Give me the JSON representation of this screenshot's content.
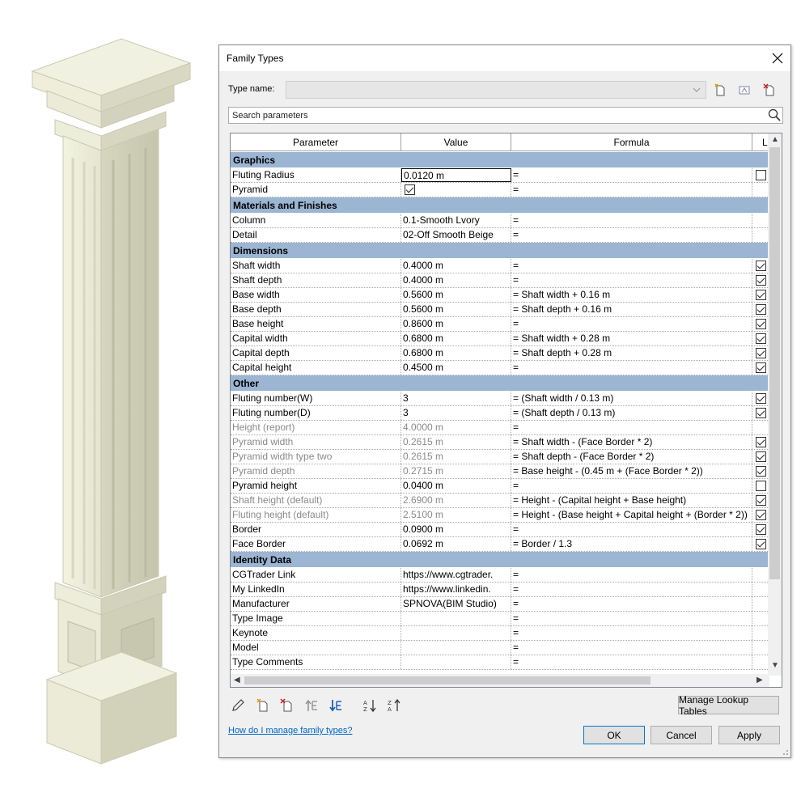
{
  "dialog": {
    "title": "Family Types",
    "type_name_label": "Type name:",
    "type_name_value": "",
    "search_placeholder": "Search parameters",
    "columns": {
      "parameter": "Parameter",
      "value": "Value",
      "formula": "Formula",
      "lock": "L"
    },
    "groups": [
      {
        "name": "Graphics",
        "rows": [
          {
            "parameter": "Fluting Radius",
            "value": "0.0120 m",
            "formula": "=",
            "lock": false,
            "disabled": false,
            "editing": true
          },
          {
            "parameter": "Pyramid",
            "value_checkbox": true,
            "value": "",
            "formula": "=",
            "lock": null,
            "disabled": false
          }
        ]
      },
      {
        "name": "Materials and Finishes",
        "rows": [
          {
            "parameter": "Column",
            "value": "0.1-Smooth Lvory",
            "formula": "=",
            "lock": null,
            "disabled": false
          },
          {
            "parameter": "Detail",
            "value": "02-Off Smooth Beige",
            "formula": "=",
            "lock": null,
            "disabled": false
          }
        ]
      },
      {
        "name": "Dimensions",
        "rows": [
          {
            "parameter": "Shaft width",
            "value": "0.4000 m",
            "formula": "=",
            "lock": true,
            "disabled": false
          },
          {
            "parameter": "Shaft depth",
            "value": "0.4000 m",
            "formula": "=",
            "lock": true,
            "disabled": false
          },
          {
            "parameter": "Base width",
            "value": "0.5600 m",
            "formula": "= Shaft width + 0.16 m",
            "lock": true,
            "disabled": false
          },
          {
            "parameter": "Base depth",
            "value": "0.5600 m",
            "formula": "= Shaft depth + 0.16 m",
            "lock": true,
            "disabled": false
          },
          {
            "parameter": "Base height",
            "value": "0.8600 m",
            "formula": "=",
            "lock": true,
            "disabled": false
          },
          {
            "parameter": "Capital width",
            "value": "0.6800 m",
            "formula": "= Shaft width + 0.28 m",
            "lock": true,
            "disabled": false
          },
          {
            "parameter": "Capital depth",
            "value": "0.6800 m",
            "formula": "= Shaft depth + 0.28 m",
            "lock": true,
            "disabled": false
          },
          {
            "parameter": "Capital height",
            "value": "0.4500 m",
            "formula": "=",
            "lock": true,
            "disabled": false
          }
        ]
      },
      {
        "name": "Other",
        "rows": [
          {
            "parameter": "Fluting number(W)",
            "value": "3",
            "formula": "= (Shaft width / 0.13 m)",
            "lock": true,
            "disabled": false
          },
          {
            "parameter": "Fluting number(D)",
            "value": "3",
            "formula": "= (Shaft depth / 0.13 m)",
            "lock": true,
            "disabled": false
          },
          {
            "parameter": "Height (report)",
            "value": "4.0000 m",
            "formula": "=",
            "lock": null,
            "disabled": true
          },
          {
            "parameter": "Pyramid width",
            "value": "0.2615 m",
            "formula": "= Shaft width - (Face Border * 2)",
            "lock": true,
            "disabled": true
          },
          {
            "parameter": "Pyramid width type two",
            "value": "0.2615 m",
            "formula": "= Shaft depth - (Face Border * 2)",
            "lock": true,
            "disabled": true
          },
          {
            "parameter": "Pyramid depth",
            "value": "0.2715 m",
            "formula": "= Base height - (0.45 m + (Face Border * 2))",
            "lock": true,
            "disabled": true
          },
          {
            "parameter": "Pyramid height",
            "value": "0.0400 m",
            "formula": "=",
            "lock": false,
            "disabled": false
          },
          {
            "parameter": "Shaft height (default)",
            "value": "2.6900 m",
            "formula": "= Height - (Capital height + Base height)",
            "lock": true,
            "disabled": true
          },
          {
            "parameter": "Fluting height (default)",
            "value": "2.5100 m",
            "formula": "= Height - (Base height + Capital height + (Border * 2))",
            "lock": true,
            "disabled": true
          },
          {
            "parameter": "Border",
            "value": "0.0900 m",
            "formula": "=",
            "lock": true,
            "disabled": false
          },
          {
            "parameter": "Face Border",
            "value": "0.0692 m",
            "formula": "= Border / 1.3",
            "lock": true,
            "disabled": false
          }
        ]
      },
      {
        "name": "Identity Data",
        "rows": [
          {
            "parameter": "CGTrader Link",
            "value": "https://www.cgtrader.",
            "formula": "=",
            "lock": null,
            "disabled": false
          },
          {
            "parameter": "My LinkedIn",
            "value": "https://www.linkedin.",
            "formula": "=",
            "lock": null,
            "disabled": false
          },
          {
            "parameter": "Manufacturer",
            "value": "SPNOVA(BIM Studio)",
            "formula": "=",
            "lock": null,
            "disabled": false
          },
          {
            "parameter": "Type Image",
            "value": "",
            "formula": "=",
            "lock": null,
            "disabled": false
          },
          {
            "parameter": "Keynote",
            "value": "",
            "formula": "=",
            "lock": null,
            "disabled": false
          },
          {
            "parameter": "Model",
            "value": "",
            "formula": "=",
            "lock": null,
            "disabled": false
          },
          {
            "parameter": "Type Comments",
            "value": "",
            "formula": "=",
            "lock": null,
            "disabled": false
          }
        ]
      }
    ],
    "buttons": {
      "manage_lookup": "Manage Lookup Tables",
      "ok": "OK",
      "cancel": "Cancel",
      "apply": "Apply"
    },
    "help_link": "How do I manage family types?"
  },
  "icons": [
    "close-icon",
    "new-type-icon",
    "rename-type-icon",
    "delete-type-icon",
    "search-icon",
    "edit-parameter-icon",
    "new-parameter-icon",
    "delete-parameter-icon",
    "move-up-icon",
    "move-down-icon",
    "sort-ascending-icon",
    "sort-descending-icon"
  ],
  "colors": {
    "group_header": "#9bb5d3",
    "link": "#0066cc",
    "column_body": "#e9e9d4"
  }
}
